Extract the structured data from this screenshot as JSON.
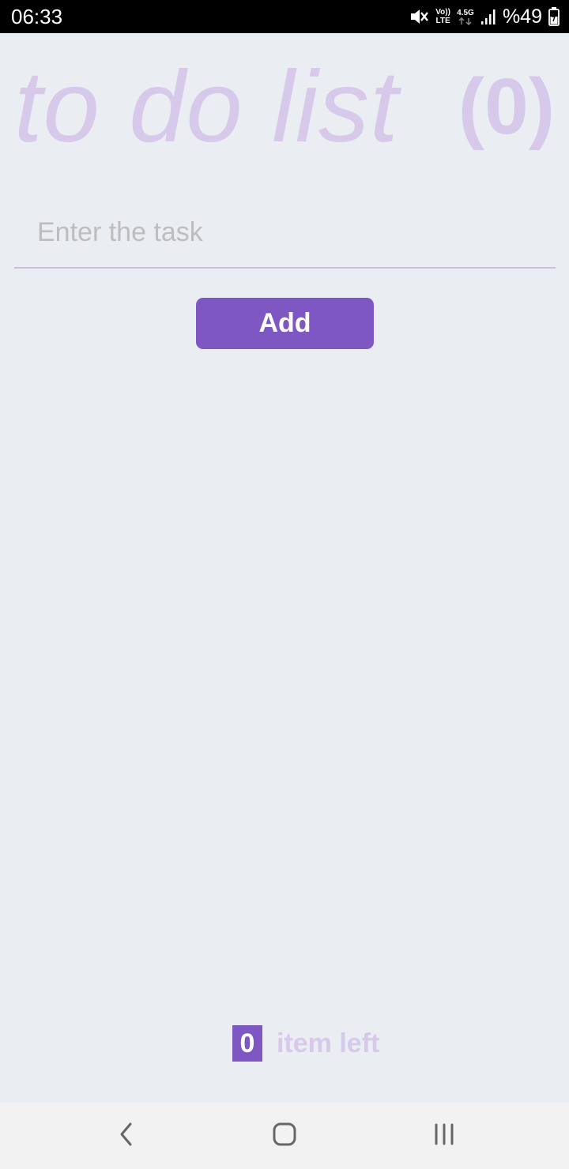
{
  "status_bar": {
    "time": "06:33",
    "volte_top": "Vo))",
    "volte_bottom": "LTE",
    "network": "4.5G",
    "battery": "%49",
    "icons": [
      "mute-icon",
      "volte-icon",
      "network-arrows-icon",
      "signal-icon",
      "battery-icon"
    ]
  },
  "header": {
    "title": "to do list",
    "count": "(0)"
  },
  "task_input": {
    "value": "",
    "placeholder": "Enter the task"
  },
  "add_button": {
    "label": "Add"
  },
  "footer": {
    "count": "0",
    "label": "item left"
  },
  "nav_bar": {
    "icons": [
      "back-icon",
      "home-icon",
      "recents-icon"
    ]
  },
  "colors": {
    "accent": "#7e57c2",
    "title": "#d6c9ea",
    "background": "#eaedf1"
  }
}
